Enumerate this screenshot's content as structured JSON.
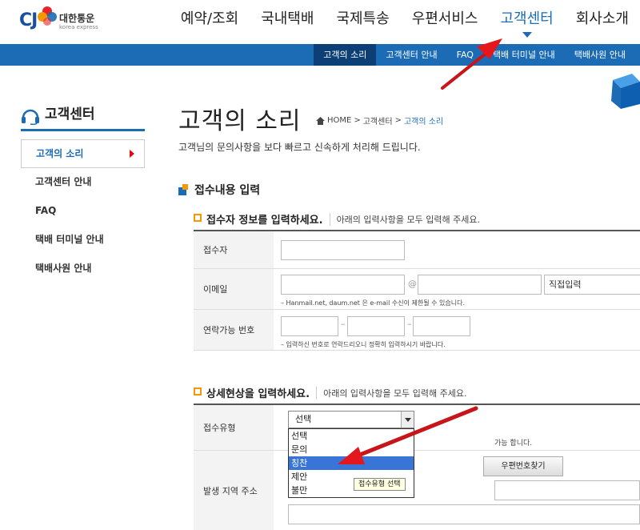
{
  "logo": {
    "mark": "CJ",
    "korean": "대한통운",
    "english": "korea express"
  },
  "gnb": [
    {
      "label": "예약/조회",
      "active": false
    },
    {
      "label": "국내택배",
      "active": false
    },
    {
      "label": "국제특송",
      "active": false
    },
    {
      "label": "우편서비스",
      "active": false
    },
    {
      "label": "고객센터",
      "active": true
    },
    {
      "label": "회사소개",
      "active": false
    }
  ],
  "lnb": [
    {
      "label": "고객의 소리",
      "active": true
    },
    {
      "label": "고객센터 안내",
      "active": false
    },
    {
      "label": "FAQ",
      "active": false
    },
    {
      "label": "택배 터미널 안내",
      "active": false
    },
    {
      "label": "택배사원 안내",
      "active": false
    }
  ],
  "sidebar": {
    "title": "고객센터",
    "items": [
      {
        "label": "고객의 소리",
        "active": true
      },
      {
        "label": "고객센터 안내",
        "active": false
      },
      {
        "label": "FAQ",
        "active": false
      },
      {
        "label": "택배 터미널 안내",
        "active": false
      },
      {
        "label": "택배사원 안내",
        "active": false
      }
    ]
  },
  "main": {
    "title": "고객의 소리",
    "breadcrumb": {
      "home": "HOME",
      "sep": ">",
      "level1": "고객센터",
      "current": "고객의 소리"
    },
    "intro": "고객님의 문의사항을 보다 빠르고 신속하게 처리해 드립니다.",
    "section_title": "접수내용 입력",
    "reporter": {
      "title": "접수자 정보를 입력하세요.",
      "note": "아래의 입력사항을 모두 입력해 주세요.",
      "labels": {
        "name": "접수자",
        "email": "이메일",
        "phone": "연락가능 번호"
      },
      "email_at": "@",
      "email_domain_select": "직접입력",
      "email_hint": "– Hanmail.net, daum.net 은 e-mail 수신이 제한될 수 있습니다.",
      "phone_hint": "– 입력하신 번호로 연락드리오니 정확히 입력하시기 바랍니다."
    },
    "detail": {
      "title": "상세현상을 입력하세요.",
      "note": "아래의 입력사항을 모두 입력해 주세요.",
      "labels": {
        "type": "접수유형",
        "address": "발생 지역 주소"
      },
      "type_selected": "선택",
      "type_options": [
        "선택",
        "문의",
        "칭찬",
        "제안",
        "불만"
      ],
      "type_highlighted": "칭찬",
      "tooltip": "접수유형 선택",
      "partial_hint": "가능 합니다.",
      "zip_button": "우편번호찾기"
    }
  },
  "colors": {
    "brand_blue": "#1b6cb5",
    "annotation_red": "#e3171c",
    "accent_orange": "#f39800"
  }
}
